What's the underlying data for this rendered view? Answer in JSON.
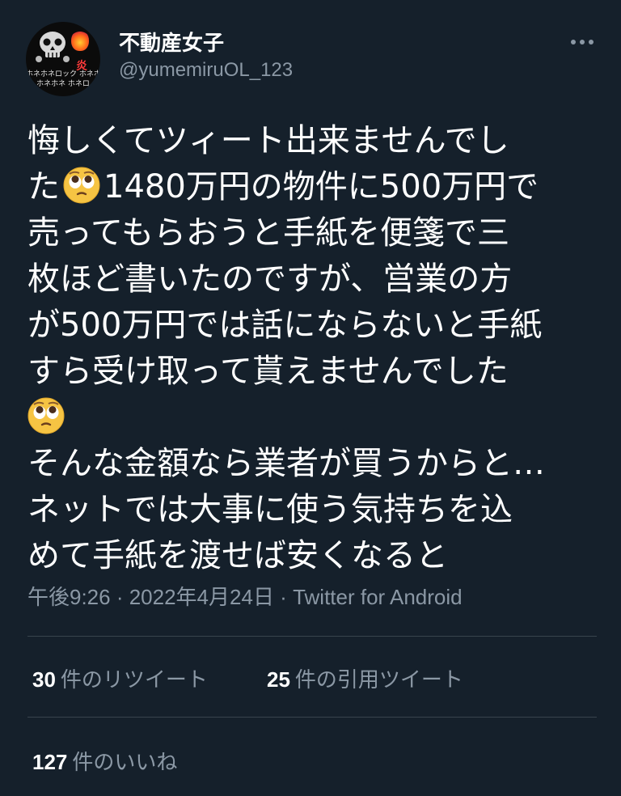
{
  "author": {
    "display_name": "不動産女子",
    "username": "@yumemiruOL_123",
    "avatar_text": [
      "ホネホネロック ホネホネロ",
      "ホネホネ ホネロ"
    ]
  },
  "tweet": {
    "lines": [
      "悔しくてツィート出来ませんでし",
      "1480万円の物件に500万円で",
      "売ってもらおうと手紙を便箋で三",
      "枚ほど書いたのですが、営業の方",
      "が500万円では話にならないと手紙",
      "すら受け取って貰えませんでした",
      "そんな金額なら業者が買うからと…",
      "ネットでは大事に使う気持ちを込",
      "めて手紙を渡せば安くなると"
    ],
    "line2_prefix": "た",
    "emoji": "pleading-face"
  },
  "meta": {
    "time": "午後9:26",
    "separator": " · ",
    "date": "2022年4月24日",
    "source": "Twitter for Android"
  },
  "stats": {
    "retweets_count": "30",
    "retweets_label": "件のリツイート",
    "quotes_count": "25",
    "quotes_label": "件の引用ツイート",
    "likes_count": "127",
    "likes_label": "件のいいね"
  },
  "colors": {
    "background": "#15202b",
    "secondary_text": "#8b98a5",
    "divider": "#38444d"
  }
}
